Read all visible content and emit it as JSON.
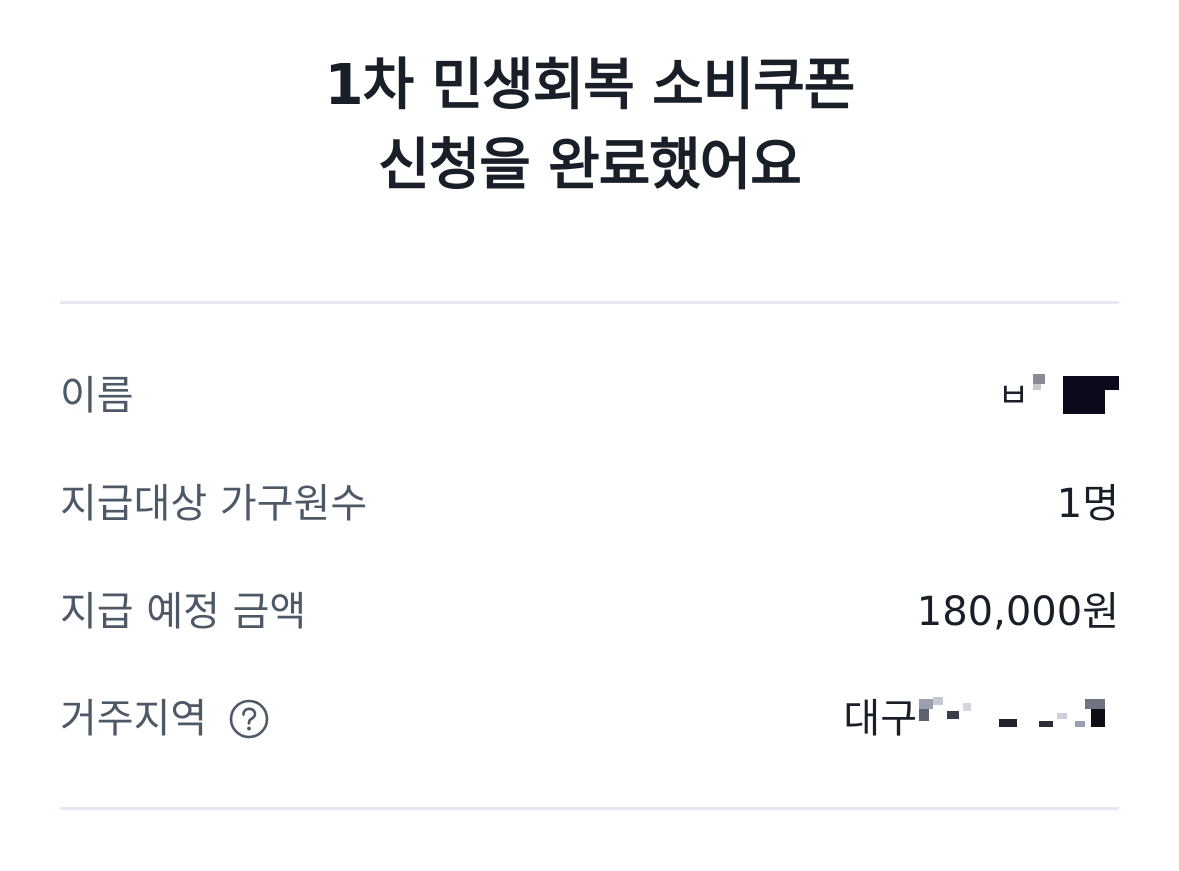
{
  "header": {
    "title_line1": "1차 민생회복 소비쿠폰",
    "title_line2": "신청을 완료했어요"
  },
  "details": {
    "name_label": "이름",
    "name_value": "ㅂ",
    "household_label": "지급대상 가구원수",
    "household_value": "1명",
    "amount_label": "지급 예정 금액",
    "amount_value": "180,000원",
    "region_label": "거주지역",
    "region_value": "대구",
    "help_icon": "question-circle-icon"
  },
  "colors": {
    "title": "#191f28",
    "label": "#4e5968",
    "value": "#191f28",
    "divider": "#e5e8f2",
    "background": "#ffffff"
  }
}
